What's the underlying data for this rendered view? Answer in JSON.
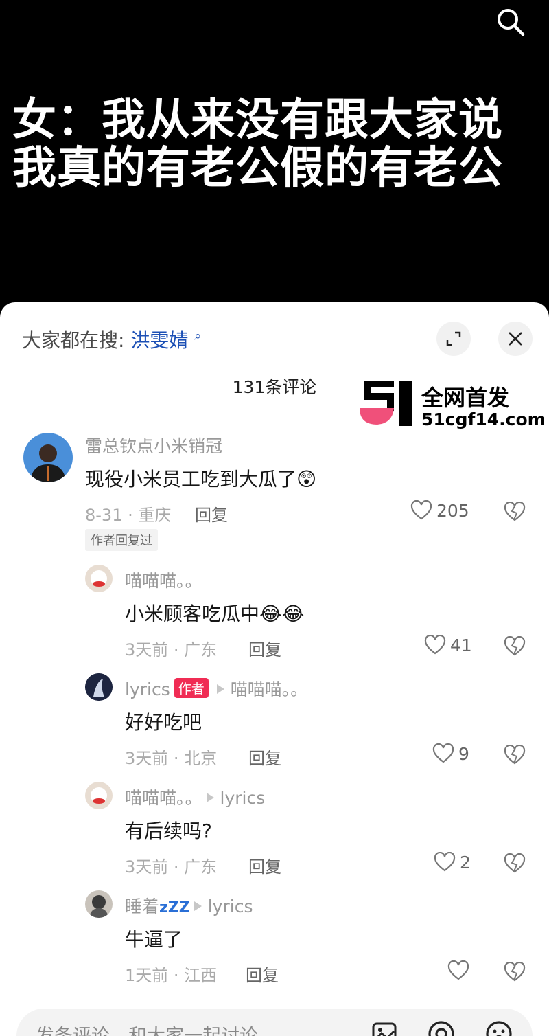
{
  "video": {
    "caption_line1": "女：我从来没有跟大家说",
    "caption_line2": "我真的有老公假的有老公"
  },
  "sheet": {
    "hot_search_prefix": "大家都在搜:",
    "hot_search_keyword": "洪雯婧",
    "comment_count": "131条评论"
  },
  "watermark": {
    "line1": "全网首发",
    "line2": "51cgf14.com"
  },
  "comments": [
    {
      "user": "雷总钦点小米销冠",
      "text": "现役小米员工吃到大瓜了",
      "emoji": "😲",
      "date": "8-31 · 重庆",
      "reply": "回复",
      "likes": "205",
      "tag": "作者回复过"
    }
  ],
  "replies": [
    {
      "user": "喵喵喵。。",
      "text": "小米顾客吃瓜中",
      "emoji": "😂😂",
      "date": "3天前 · 广东",
      "reply": "回复",
      "likes": "41"
    },
    {
      "user": "lyrics",
      "badge": "作者",
      "to": "喵喵喵。。",
      "text": "好好吃吧",
      "date": "3天前 · 北京",
      "reply": "回复",
      "likes": "9"
    },
    {
      "user": "喵喵喵。。",
      "to": "lyrics",
      "text": "有后续吗?",
      "date": "3天前 · 广东",
      "reply": "回复",
      "likes": "2"
    },
    {
      "user": "睡着",
      "user_suffix": "zZZ",
      "to": "lyrics",
      "text": "牛逼了",
      "date": "1天前 · 江西",
      "reply": "回复",
      "likes": ""
    }
  ],
  "input": {
    "placeholder": "发条评论，和大家一起讨论"
  },
  "colors": {
    "accent": "#1b4fb5",
    "author_badge": "#f02c54",
    "watermark_pink": "#f0507a"
  },
  "icons": [
    "search-icon",
    "expand-icon",
    "close-icon",
    "heart-icon",
    "dislike-heart-icon",
    "image-icon",
    "at-icon",
    "emoji-icon"
  ]
}
